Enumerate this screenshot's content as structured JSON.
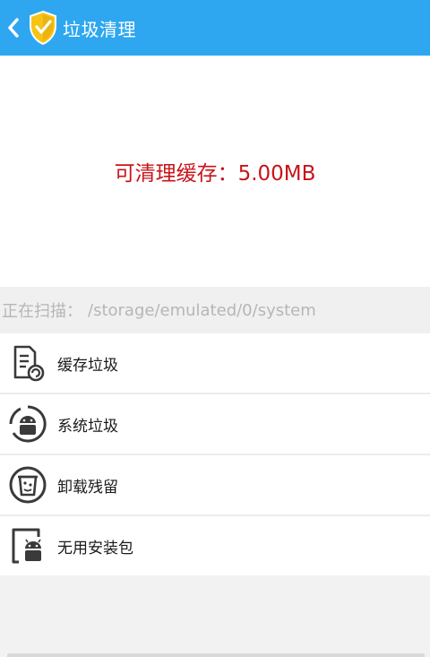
{
  "header": {
    "title": "垃圾清理",
    "back_icon": "chevron-left-icon",
    "logo_icon": "shield-check-icon"
  },
  "summary": {
    "text": "可清理缓存：5.00MB"
  },
  "scan": {
    "label": "正在扫描：",
    "path": "/storage/emulated/0/system"
  },
  "items": [
    {
      "label": "缓存垃圾",
      "icon": "cache-document-icon"
    },
    {
      "label": "系统垃圾",
      "icon": "android-system-icon"
    },
    {
      "label": "卸载残留",
      "icon": "trash-bin-icon"
    },
    {
      "label": "无用安装包",
      "icon": "apk-package-icon"
    }
  ],
  "colors": {
    "header_bg": "#2ea7f0",
    "summary_text": "#c8141b",
    "scan_text": "#b6b6b6",
    "shield": "#f5c414"
  }
}
